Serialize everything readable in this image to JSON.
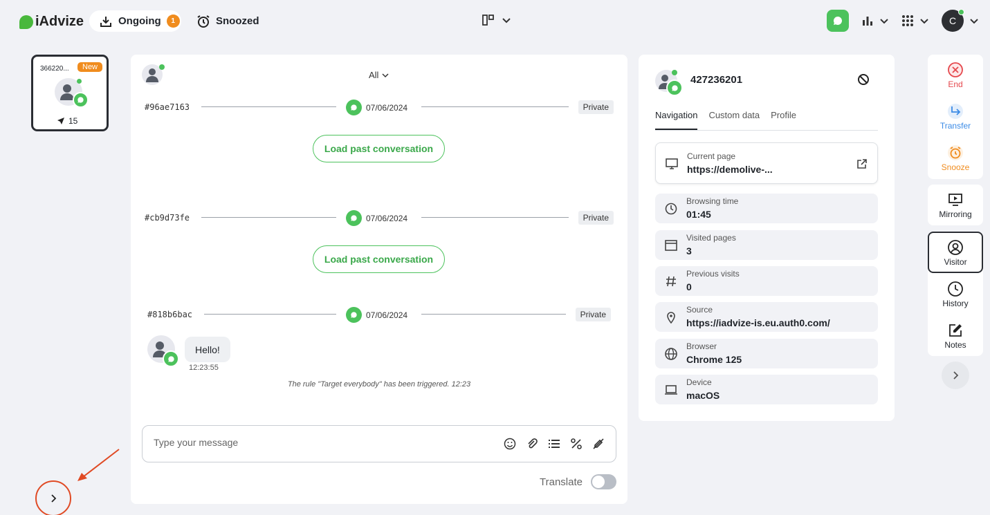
{
  "header": {
    "brand": "iAdvize",
    "tabs": [
      {
        "label": "Ongoing",
        "count": "1"
      },
      {
        "label": "Snoozed"
      }
    ],
    "user_initial": "C"
  },
  "queue": {
    "card": {
      "id": "366220...",
      "badge": "New",
      "count": "15"
    }
  },
  "chat": {
    "filter": "All",
    "sections": [
      {
        "hash": "#96ae7163",
        "date": "07/06/2024",
        "tag": "Private",
        "load_label": "Load past conversation"
      },
      {
        "hash": "#cb9d73fe",
        "date": "07/06/2024",
        "tag": "Private",
        "load_label": "Load past conversation"
      },
      {
        "hash": "#818b6bac",
        "date": "07/06/2024",
        "tag": "Private"
      }
    ],
    "message": {
      "text": "Hello!",
      "time": "12:23:55"
    },
    "system_message": "The rule \"Target everybody\" has been triggered.   12:23",
    "input_placeholder": "Type your message",
    "translate_label": "Translate",
    "translate_on": false
  },
  "info": {
    "visitor_id": "427236201",
    "tabs": [
      "Navigation",
      "Custom data",
      "Profile"
    ],
    "active_tab": "Navigation",
    "rows": [
      {
        "label": "Current page",
        "value": "https://demolive-...",
        "icon": "monitor-icon"
      },
      {
        "label": "Browsing time",
        "value": "01:45",
        "icon": "clock-icon"
      },
      {
        "label": "Visited pages",
        "value": "3",
        "icon": "browser-window-icon"
      },
      {
        "label": "Previous visits",
        "value": "0",
        "icon": "hash-icon"
      },
      {
        "label": "Source",
        "value": "https://iadvize-is.eu.auth0.com/",
        "icon": "location-pin-icon"
      },
      {
        "label": "Browser",
        "value": "Chrome 125",
        "icon": "globe-icon"
      },
      {
        "label": "Device",
        "value": "macOS",
        "icon": "laptop-icon"
      }
    ]
  },
  "actions": {
    "end": "End",
    "transfer": "Transfer",
    "snooze": "Snooze",
    "mirroring": "Mirroring",
    "visitor": "Visitor",
    "history": "History",
    "notes": "Notes"
  },
  "colors": {
    "brand_green": "#4cc25c",
    "end_red": "#e5484d",
    "transfer_blue": "#3b8be6",
    "snooze_orange": "#f08c1e",
    "annotation_red": "#e04a24"
  }
}
